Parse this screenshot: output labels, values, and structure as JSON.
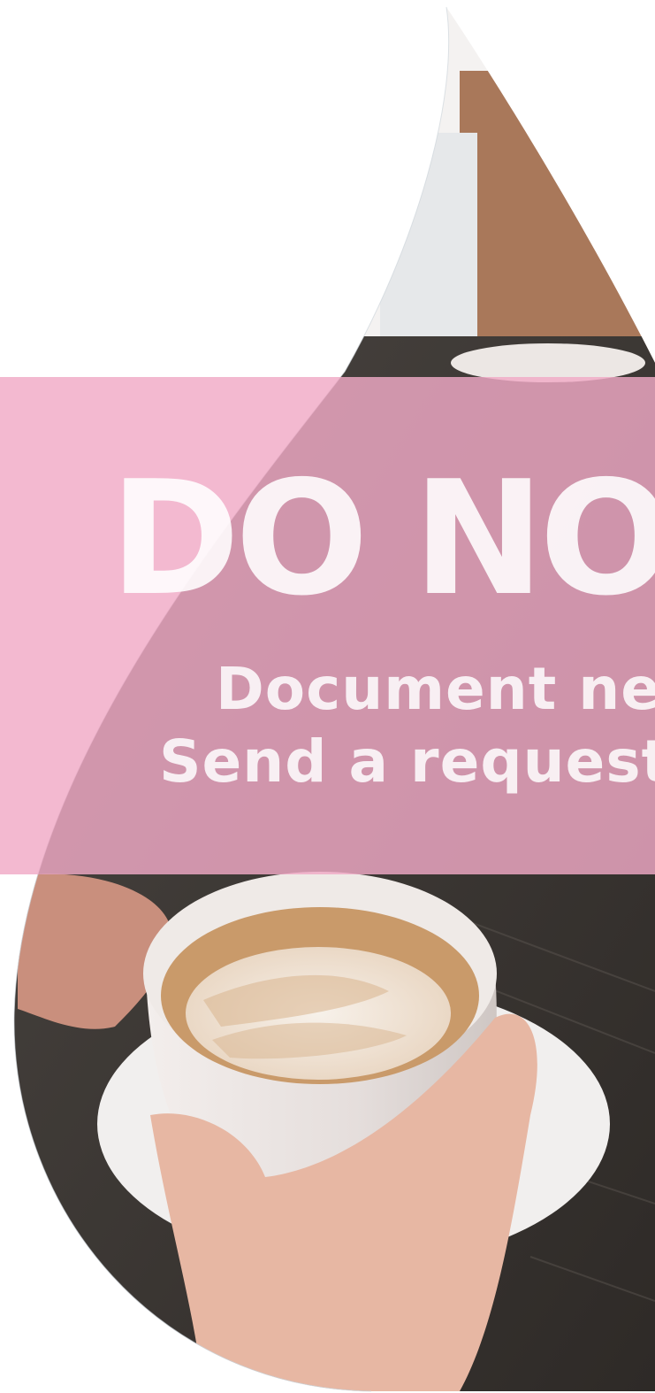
{
  "image": {
    "subject": "latte-in-cup-photo",
    "shape": "droplet",
    "colors": {
      "band": "#f0aac6",
      "table": "#3a3633",
      "cup": "#ece8e6",
      "crema": "#c99a6a",
      "foam": "#f6efe8",
      "skin": "#e7b7a3"
    }
  },
  "watermark": {
    "title": "DO NOT",
    "line1": "Document ne",
    "line2": "Send a request"
  }
}
